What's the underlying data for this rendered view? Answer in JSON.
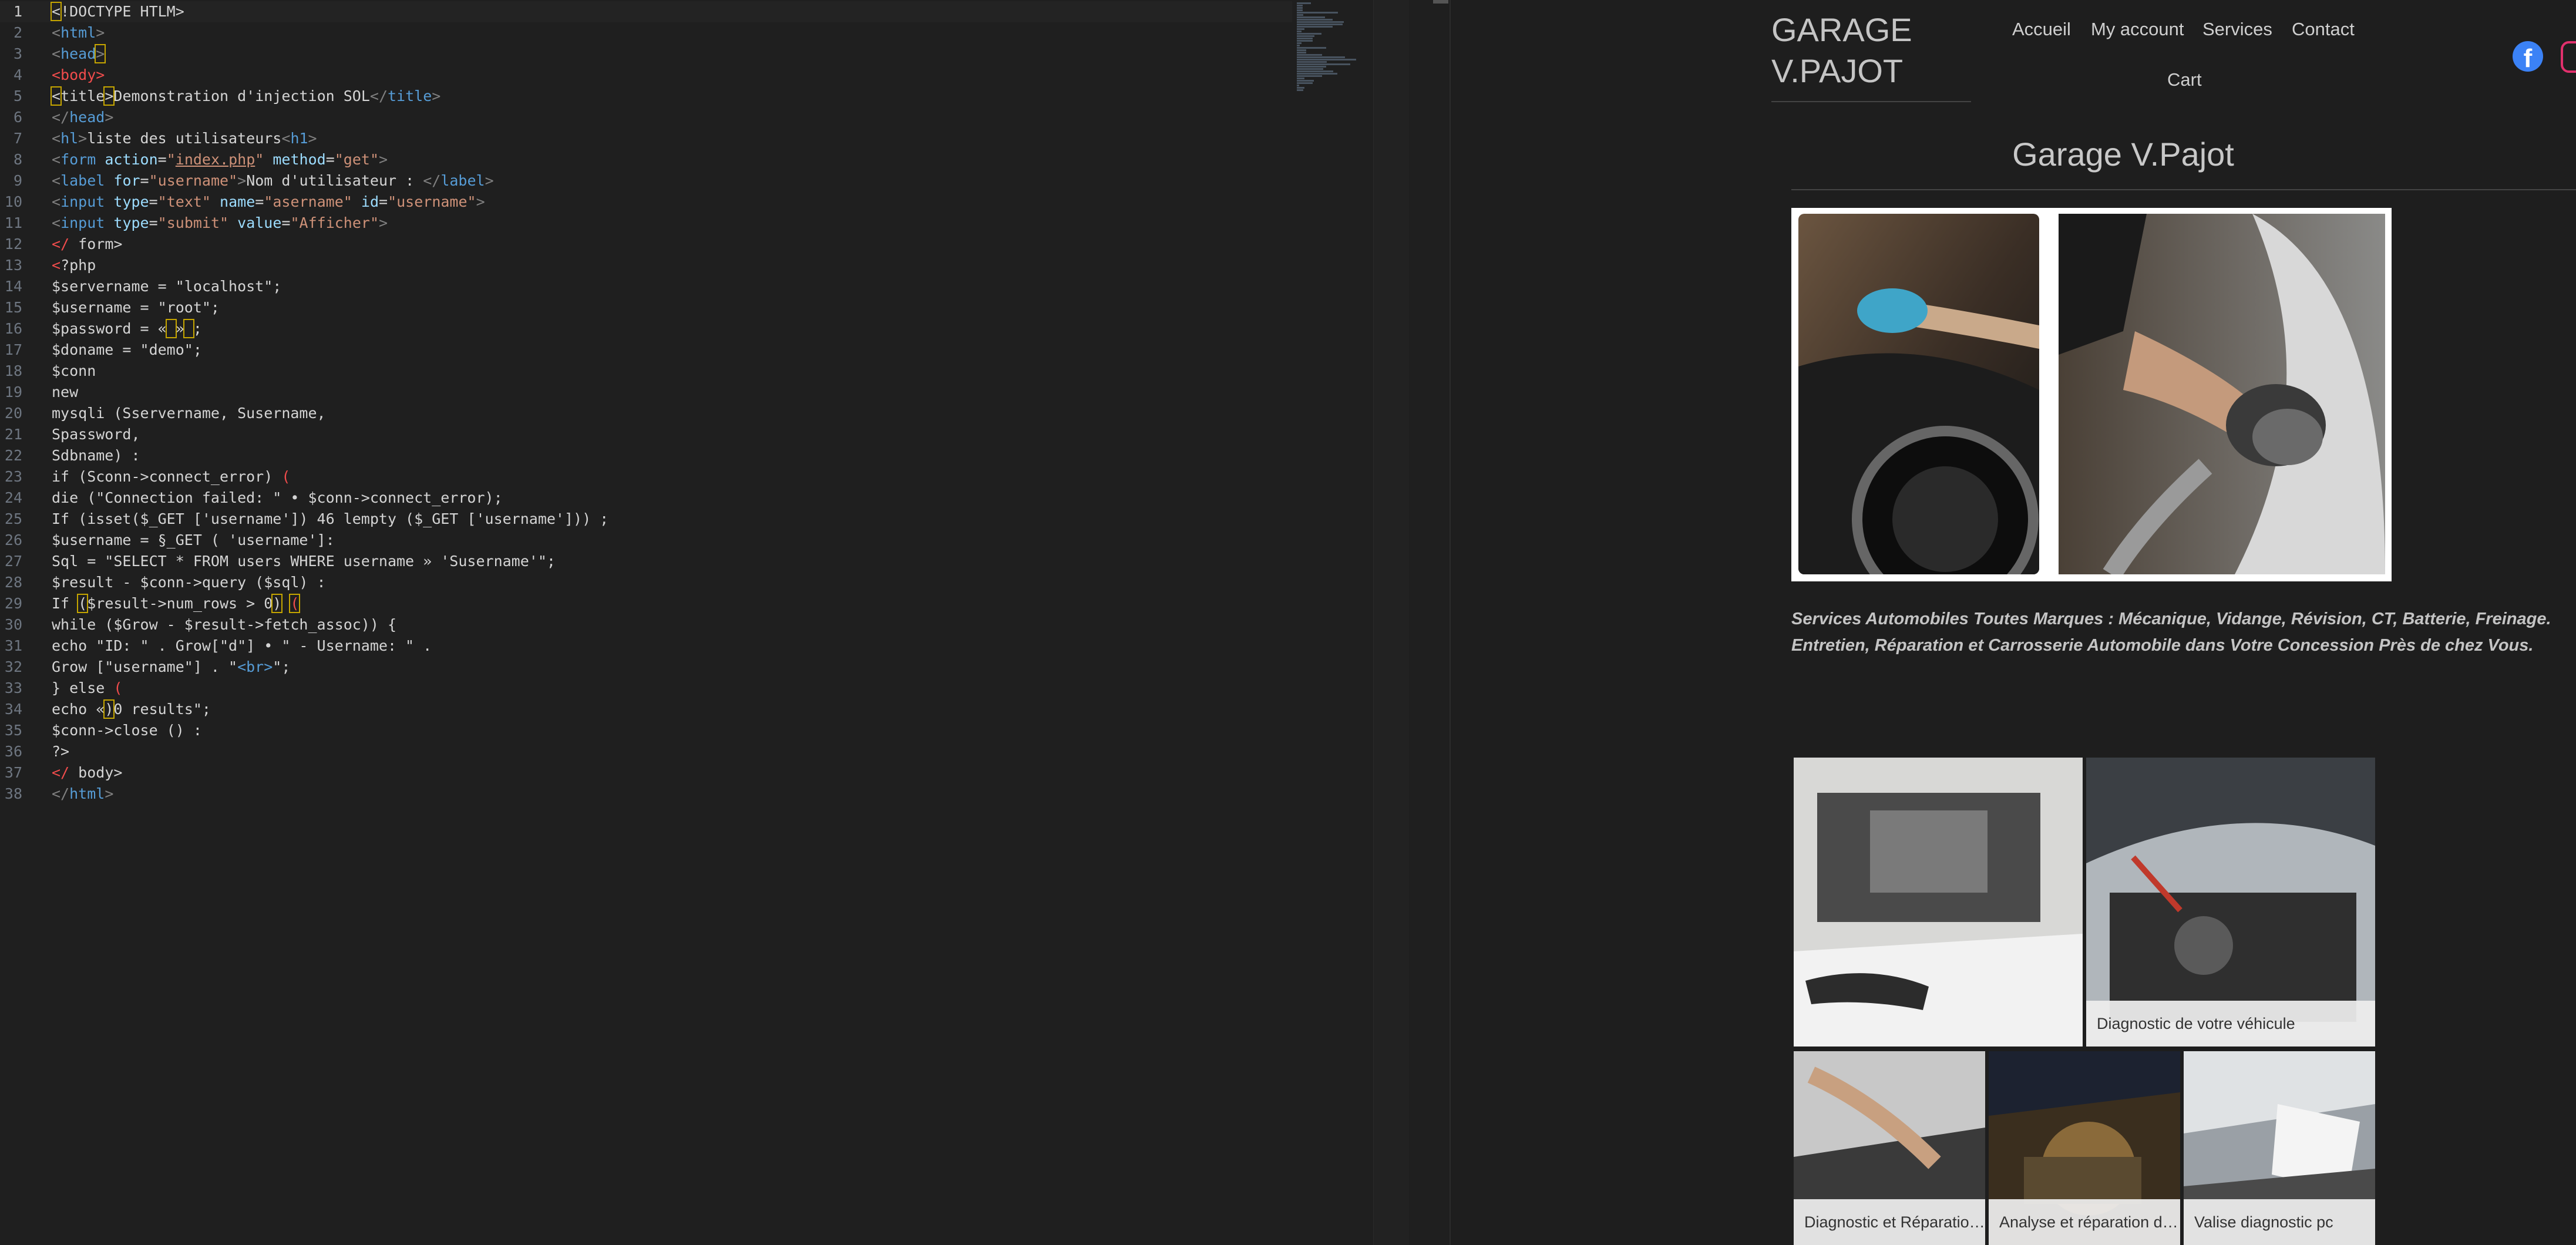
{
  "editor": {
    "lines": [
      {
        "n": "1",
        "current": true,
        "html": "<span class=\"box\">&lt;</span>!DOCTYPE HTLM&gt;"
      },
      {
        "n": "2",
        "html": "<span class=\"t-ang\">&lt;</span><span class=\"t-tag\">html</span><span class=\"t-ang\">&gt;</span>"
      },
      {
        "n": "3",
        "html": "<span class=\"t-ang\">&lt;</span><span class=\"t-tag\">head</span><span class=\"t-ang box\">&gt;</span>"
      },
      {
        "n": "4",
        "html": "<span class=\"t-red\">&lt;body&gt;</span>"
      },
      {
        "n": "5",
        "html": "<span class=\"box\">&lt;</span>title<span class=\"box\">&gt;</span>Demonstration d'injection SOL<span class=\"t-ang\">&lt;/</span><span class=\"t-tag\">title</span><span class=\"t-ang\">&gt;</span>"
      },
      {
        "n": "6",
        "html": "<span class=\"t-ang\">&lt;/</span><span class=\"t-tag\">head</span><span class=\"t-ang\">&gt;</span>"
      },
      {
        "n": "7",
        "html": "<span class=\"t-ang\">&lt;</span><span class=\"t-tag\">hl</span><span class=\"t-ang\">&gt;</span>liste des utilisateurs<span class=\"t-ang\">&lt;</span><span class=\"t-tag\">h1</span><span class=\"t-ang\">&gt;</span>"
      },
      {
        "n": "8",
        "html": "<span class=\"t-ang\">&lt;</span><span class=\"t-tag\">form</span> <span class=\"t-attr\">action</span>=<span class=\"t-str\">\"<span class=\"t-link\">index.php</span>\"</span> <span class=\"t-attr\">method</span>=<span class=\"t-str\">\"get\"</span><span class=\"t-ang\">&gt;</span>"
      },
      {
        "n": "9",
        "html": "<span class=\"t-ang\">&lt;</span><span class=\"t-tag\">label</span> <span class=\"t-attr\">for</span>=<span class=\"t-str\">\"username\"</span><span class=\"t-ang\">&gt;</span>Nom d'utilisateur : <span class=\"t-ang\">&lt;/</span><span class=\"t-tag\">label</span><span class=\"t-ang\">&gt;</span>"
      },
      {
        "n": "10",
        "html": "<span class=\"t-ang\">&lt;</span><span class=\"t-tag\">input</span> <span class=\"t-attr\">type</span>=<span class=\"t-str\">\"text\"</span> <span class=\"t-attr\">name</span>=<span class=\"t-str\">\"asername\"</span> <span class=\"t-attr\">id</span>=<span class=\"t-str\">\"username\"</span><span class=\"t-ang\">&gt;</span>"
      },
      {
        "n": "11",
        "html": "<span class=\"t-ang\">&lt;</span><span class=\"t-tag\">input</span> <span class=\"t-attr\">type</span>=<span class=\"t-str\">\"submit\"</span> <span class=\"t-attr\">value</span>=<span class=\"t-str\">\"Afficher\"</span><span class=\"t-ang\">&gt;</span>"
      },
      {
        "n": "12",
        "html": "<span class=\"t-red\">&lt;/</span> form&gt;"
      },
      {
        "n": "13",
        "html": "<span class=\"t-red\">&lt;</span>?php"
      },
      {
        "n": "14",
        "html": "$servername = \"localhost\";"
      },
      {
        "n": "15",
        "html": "$username = \"root\";"
      },
      {
        "n": "16",
        "html": "$password = «<span class=\"box\"> </span>»<span class=\"box\"> </span>;"
      },
      {
        "n": "17",
        "html": "$doname = \"demo\";"
      },
      {
        "n": "18",
        "html": "$conn"
      },
      {
        "n": "19",
        "html": "new"
      },
      {
        "n": "20",
        "html": "mysqli (Sservername, Susername,"
      },
      {
        "n": "21",
        "html": "Spassword,"
      },
      {
        "n": "22",
        "html": "Sdbname) :"
      },
      {
        "n": "23",
        "html": "if (Sconn-&gt;connect_error) <span class=\"t-red\">(</span>"
      },
      {
        "n": "24",
        "html": "die (\"Connection failed: \" • $conn-&gt;connect_error);"
      },
      {
        "n": "25",
        "html": "If (isset($_GET ['username']) 46 lempty ($_GET ['username'])) ;"
      },
      {
        "n": "26",
        "html": "$username = §_GET ( 'username']:"
      },
      {
        "n": "27",
        "html": "Sql = \"SELECT * FROM users WHERE username » 'Susername'\";"
      },
      {
        "n": "28",
        "html": "$result - $conn-&gt;query ($sql) :"
      },
      {
        "n": "29",
        "html": "If <span class=\"box\">(</span>$result-&gt;num_rows &gt; 0<span class=\"box\">)</span> <span class=\"box t-red\">(</span>"
      },
      {
        "n": "30",
        "html": "while ($Grow - $result-&gt;fetch_assoc)) {"
      },
      {
        "n": "31",
        "html": "echo \"ID: \" . Grow[\"d\"] • \" - Username: \" ."
      },
      {
        "n": "32",
        "html": "Grow [\"username\"] . \"<span class=\"t-tag\">&lt;br&gt;</span>\";"
      },
      {
        "n": "33",
        "html": "} else <span class=\"t-red\">(</span>"
      },
      {
        "n": "34",
        "html": "echo «<span class=\"box\">)</span>0 results\";"
      },
      {
        "n": "35",
        "html": "$conn-&gt;close () :"
      },
      {
        "n": "36",
        "html": "?&gt;"
      },
      {
        "n": "37",
        "html": "<span class=\"t-red\">&lt;/</span> body&gt;"
      },
      {
        "n": "38",
        "html": "<span class=\"t-ang\">&lt;/</span><span class=\"t-tag\">html</span><span class=\"t-ang\">&gt;</span>"
      }
    ]
  },
  "preview": {
    "logo": "GARAGE\nV.PAJOT",
    "nav": [
      {
        "key": "accueil",
        "label": "Accueil"
      },
      {
        "key": "my-account",
        "label": "My account"
      },
      {
        "key": "services",
        "label": "Services"
      },
      {
        "key": "contact",
        "label": "Contact"
      },
      {
        "key": "cart",
        "label": "Cart"
      }
    ],
    "social": {
      "facebook_icon": "facebook-icon",
      "instagram_icon": "instagram-icon",
      "facebook_color": "#3b82f6",
      "instagram_color": "#e1306c"
    },
    "heading": "Garage V.Pajot",
    "tagline": "Services Automobiles Toutes Marques : Mécanique, Vidange, Révision, CT, Batterie, Freinage. Entretien, Réparation et Carrosserie Automobile dans Votre Concession Près de chez Vous.",
    "gallery_captions": [
      "Diagnostic de votre véhicule",
      "Diagnostic et Réparation des",
      "Analyse et réparation d…",
      "Valise diagnostic pc"
    ]
  }
}
